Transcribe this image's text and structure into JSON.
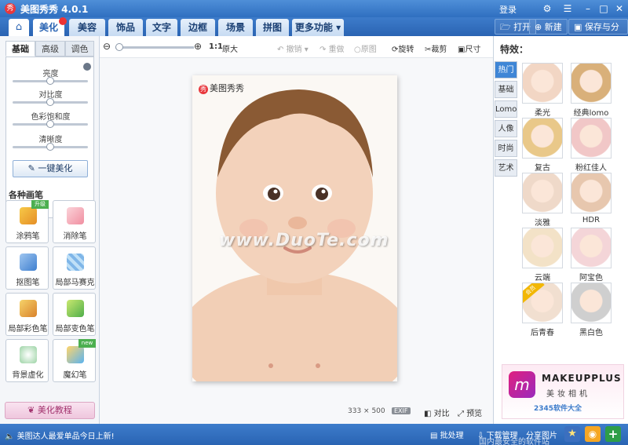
{
  "titlebar": {
    "app_title": "美图秀秀 4.0.1",
    "login": "登录",
    "logo_glyph": "秀"
  },
  "menu": {
    "tabs": [
      "美化",
      "美容",
      "饰品",
      "文字",
      "边框",
      "场景",
      "拼图",
      "更多功能"
    ],
    "active_index": 0,
    "open": "打开",
    "new": "新建",
    "save_share": "保存与分享"
  },
  "left": {
    "subtabs": [
      "基础",
      "高级",
      "调色"
    ],
    "sliders": [
      {
        "label": "亮度",
        "value": 0.5
      },
      {
        "label": "对比度",
        "value": 0.5
      },
      {
        "label": "色彩饱和度",
        "value": 0.5
      },
      {
        "label": "清晰度",
        "value": 0.5
      }
    ],
    "one_key": "一键美化",
    "brushes_title": "各种画笔",
    "brushes": [
      {
        "label": "涂鸦笔",
        "badge": "升级"
      },
      {
        "label": "消除笔",
        "badge": ""
      },
      {
        "label": "抠图笔",
        "badge": ""
      },
      {
        "label": "局部马赛克",
        "badge": ""
      },
      {
        "label": "局部彩色笔",
        "badge": ""
      },
      {
        "label": "局部变色笔",
        "badge": ""
      },
      {
        "label": "背景虚化",
        "badge": ""
      },
      {
        "label": "魔幻笔",
        "badge": "new"
      }
    ],
    "tutorial": "美化教程"
  },
  "toolbar": {
    "ratio": "1:1",
    "original_size": "原大",
    "undo": "撤销",
    "redo": "重做",
    "original": "原图",
    "rotate": "旋转",
    "crop": "裁剪",
    "size": "尺寸"
  },
  "canvas": {
    "photo_logo": "美图秀秀",
    "watermark": "www.DuoTe.com",
    "dimensions": "333 × 500",
    "exif": "EXIF",
    "compare": "对比",
    "preview": "预览"
  },
  "right": {
    "title": "特效：",
    "categories": [
      "热门",
      "基础",
      "Lomo",
      "人像",
      "时尚",
      "艺术"
    ],
    "active_category": 0,
    "effects": [
      {
        "label": "柔光",
        "tone": "#f2d6c4"
      },
      {
        "label": "经典lomo",
        "tone": "#d9b07a"
      },
      {
        "label": "复古",
        "tone": "#e9c889"
      },
      {
        "label": "粉红佳人",
        "tone": "#f1c7c7"
      },
      {
        "label": "淡雅",
        "tone": "#efd9c9"
      },
      {
        "label": "HDR",
        "tone": "#e7c7ae"
      },
      {
        "label": "云端",
        "tone": "#f3e2c7"
      },
      {
        "label": "阿宝色",
        "tone": "#f4d5d8"
      },
      {
        "label": "后青春",
        "tone": "#f1dfd0",
        "badge": "会员"
      },
      {
        "label": "黑白色",
        "tone": "#cfcfcf"
      }
    ],
    "ad": {
      "logo": "m",
      "brand": "MAKEUPPLUS",
      "sub": "美妆相机",
      "watermark": "2345软件大全"
    }
  },
  "status": {
    "news": "美图达人最爱单品今日上新!",
    "batch": "批处理",
    "download": "下载管理",
    "share": "分享图片",
    "tagline": "国内最安全的软件站"
  },
  "colors": {
    "brand_blue": "#2f6fc0",
    "accent_red": "#e8383d",
    "active_blue": "#3f86d6"
  }
}
